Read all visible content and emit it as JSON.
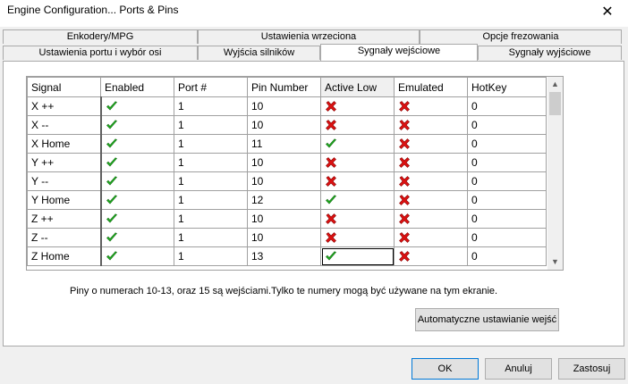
{
  "window": {
    "title": "Engine Configuration... Ports & Pins",
    "close_glyph": "✕"
  },
  "tabs": {
    "back_row": [
      "Enkodery/MPG",
      "Ustawienia wrzeciona",
      "Opcje frezowania"
    ],
    "front_row": [
      "Ustawienia portu i wybór osi",
      "Wyjścia silników",
      "Sygnały wejściowe",
      "Sygnały wyjściowe"
    ],
    "active": "Sygnały wejściowe"
  },
  "grid": {
    "headers": [
      "Signal",
      "Enabled",
      "Port #",
      "Pin Number",
      "Active Low",
      "Emulated",
      "HotKey"
    ],
    "rows": [
      {
        "signal": "X ++",
        "enabled": true,
        "port": "1",
        "pin": "10",
        "active_low": false,
        "emulated": false,
        "hotkey": "0"
      },
      {
        "signal": "X --",
        "enabled": true,
        "port": "1",
        "pin": "10",
        "active_low": false,
        "emulated": false,
        "hotkey": "0"
      },
      {
        "signal": "X Home",
        "enabled": true,
        "port": "1",
        "pin": "11",
        "active_low": true,
        "emulated": false,
        "hotkey": "0"
      },
      {
        "signal": "Y ++",
        "enabled": true,
        "port": "1",
        "pin": "10",
        "active_low": false,
        "emulated": false,
        "hotkey": "0"
      },
      {
        "signal": "Y --",
        "enabled": true,
        "port": "1",
        "pin": "10",
        "active_low": false,
        "emulated": false,
        "hotkey": "0"
      },
      {
        "signal": "Y Home",
        "enabled": true,
        "port": "1",
        "pin": "12",
        "active_low": true,
        "emulated": false,
        "hotkey": "0"
      },
      {
        "signal": "Z ++",
        "enabled": true,
        "port": "1",
        "pin": "10",
        "active_low": false,
        "emulated": false,
        "hotkey": "0"
      },
      {
        "signal": "Z --",
        "enabled": true,
        "port": "1",
        "pin": "10",
        "active_low": false,
        "emulated": false,
        "hotkey": "0"
      },
      {
        "signal": "Z Home",
        "enabled": true,
        "port": "1",
        "pin": "13",
        "active_low": true,
        "emulated": false,
        "hotkey": "0"
      }
    ],
    "focused_cell": {
      "row": 8,
      "col": "active_low"
    }
  },
  "info_text": "Piny o numerach 10-13, oraz 15 są wejściami.Tylko te numery mogą być używane na tym ekranie.",
  "buttons": {
    "auto_config": "Automatyczne ustawianie wejść",
    "ok": "OK",
    "cancel": "Anuluj",
    "apply": "Zastosuj"
  },
  "icons": {
    "true": "green-check-icon",
    "false": "red-x-icon"
  },
  "colors": {
    "check": "#22bb22",
    "cross": "#dd1111",
    "default_button_border": "#0078d7"
  }
}
